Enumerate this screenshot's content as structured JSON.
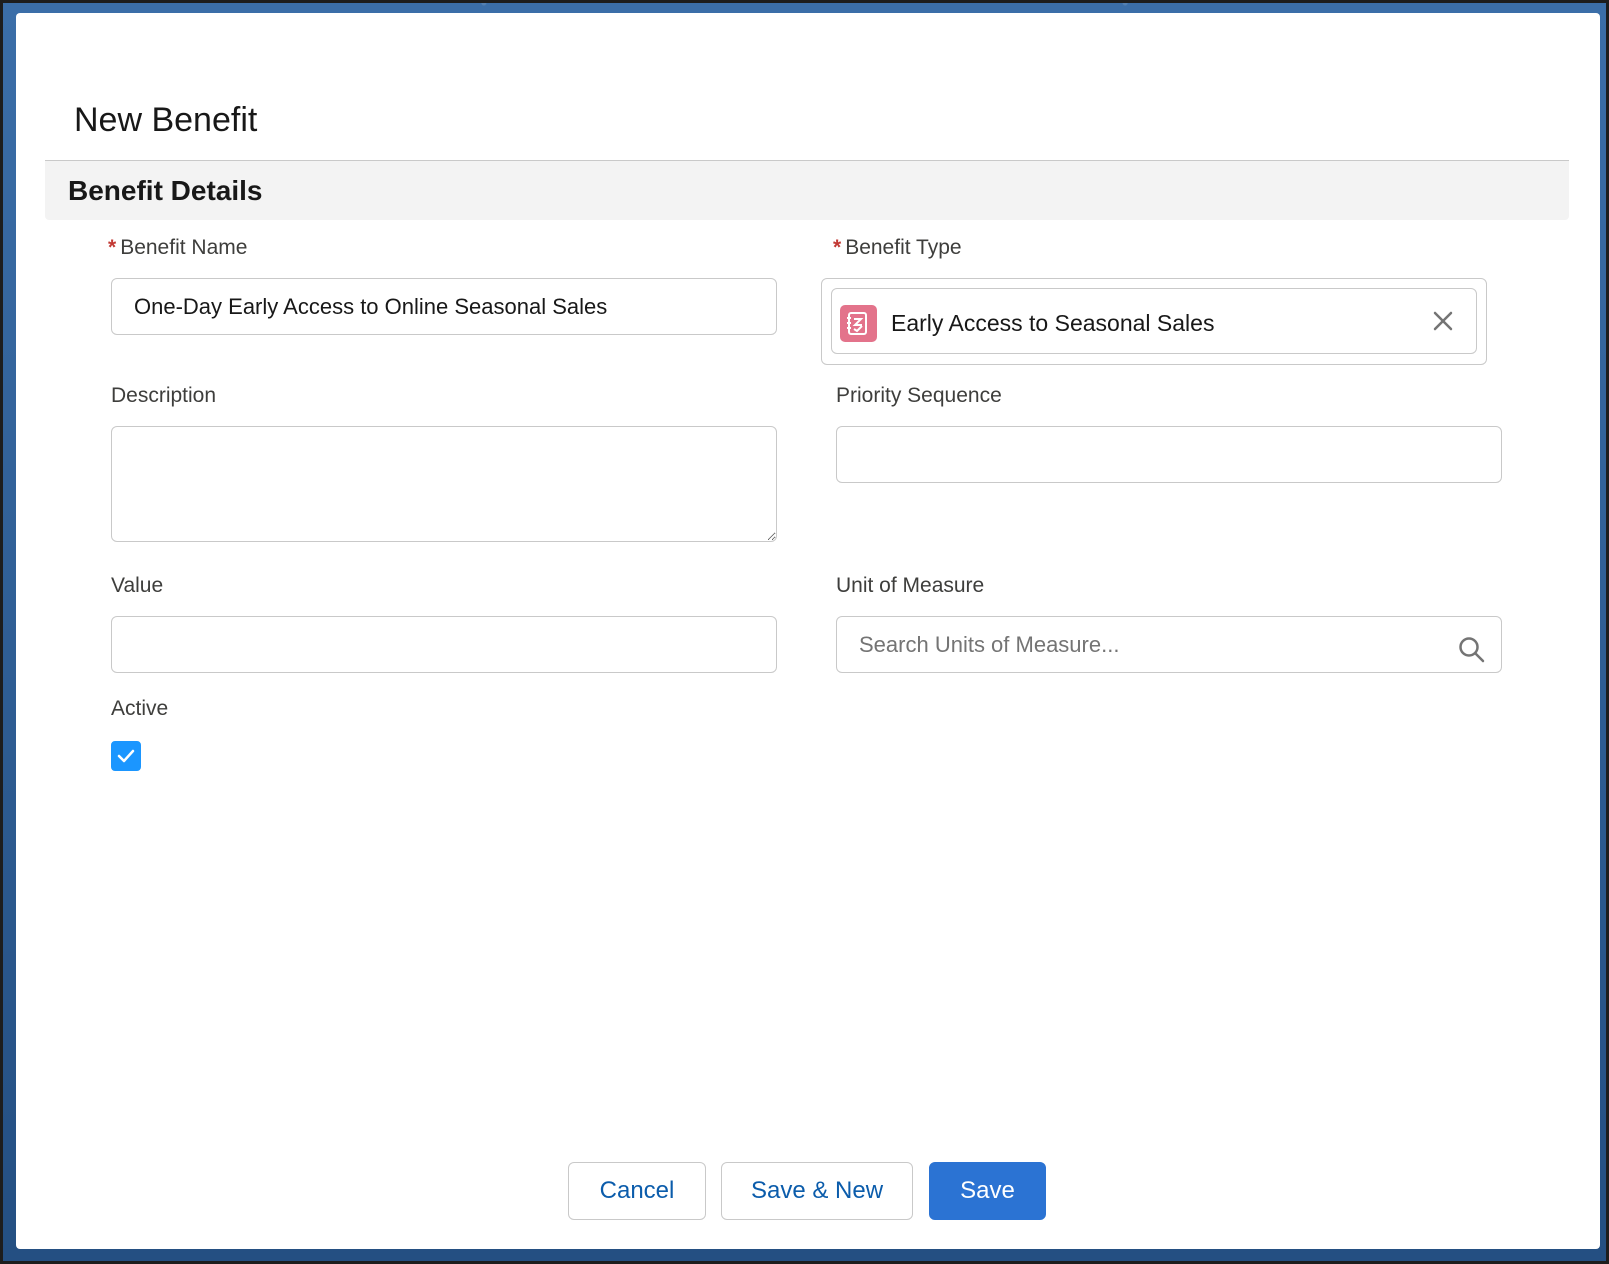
{
  "modal": {
    "title": "New Benefit"
  },
  "section": {
    "title": "Benefit Details"
  },
  "fields": {
    "benefit_name": {
      "required_mark": "*",
      "label": "Benefit Name",
      "value": "One-Day Early Access to Online Seasonal Sales"
    },
    "benefit_type": {
      "required_mark": "*",
      "label": "Benefit Type",
      "selected": "Early Access to Seasonal Sales",
      "icon": "benefit-type-icon"
    },
    "description": {
      "label": "Description",
      "value": ""
    },
    "priority_sequence": {
      "label": "Priority Sequence",
      "value": ""
    },
    "value": {
      "label": "Value",
      "value": ""
    },
    "unit_of_measure": {
      "label": "Unit of Measure",
      "placeholder": "Search Units of Measure..."
    },
    "active": {
      "label": "Active",
      "checked": true
    }
  },
  "footer": {
    "cancel_label": "Cancel",
    "save_new_label": "Save & New",
    "save_label": "Save"
  },
  "colors": {
    "primary": "#2b73d3",
    "link": "#0b5cab",
    "required": "#c23934",
    "checkbox": "#1b96ff",
    "pill_icon": "#e3738b"
  }
}
